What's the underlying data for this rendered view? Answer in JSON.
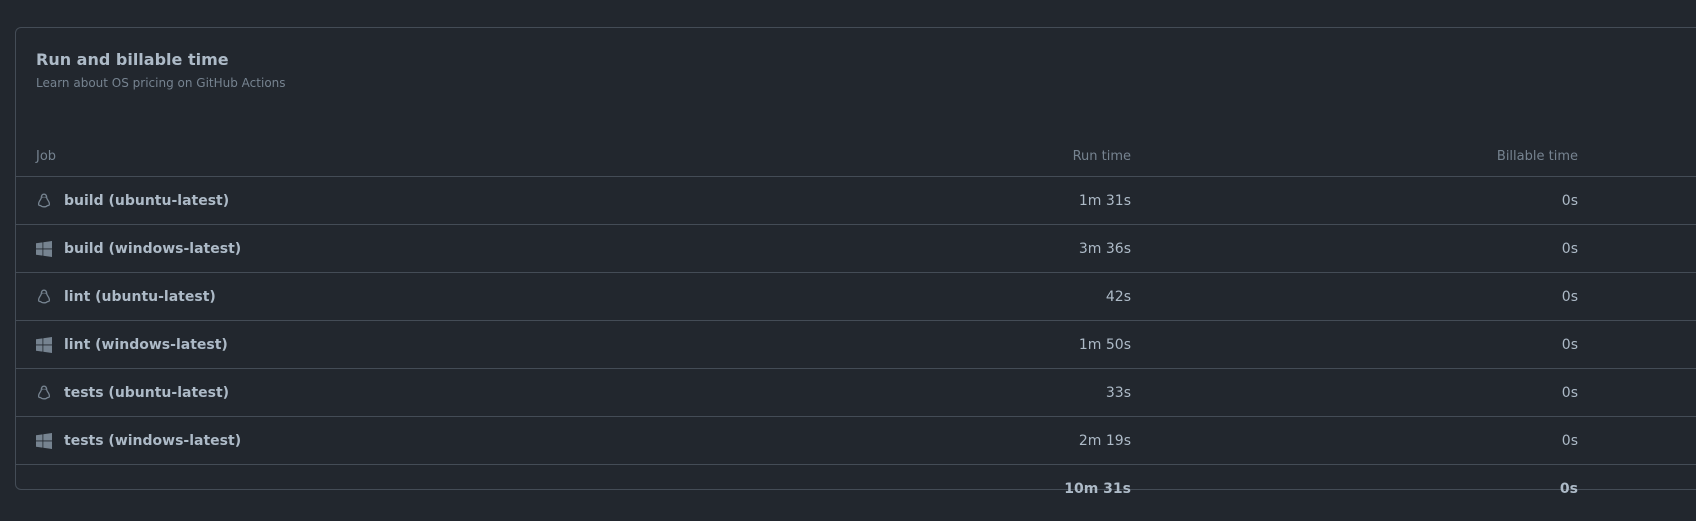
{
  "header": {
    "title": "Run and billable time",
    "subtitle_link": "Learn about OS pricing on GitHub Actions"
  },
  "table": {
    "columns": [
      "Job",
      "Run time",
      "Billable time"
    ],
    "rows": [
      {
        "name": "build (ubuntu-latest)",
        "os_icon": "linux-icon",
        "run_time": "1m 31s",
        "billable_time": "0s"
      },
      {
        "name": "build (windows-latest)",
        "os_icon": "windows-icon",
        "run_time": "3m 36s",
        "billable_time": "0s"
      },
      {
        "name": "lint (ubuntu-latest)",
        "os_icon": "linux-icon",
        "run_time": "42s",
        "billable_time": "0s"
      },
      {
        "name": "lint (windows-latest)",
        "os_icon": "windows-icon",
        "run_time": "1m 50s",
        "billable_time": "0s"
      },
      {
        "name": "tests (ubuntu-latest)",
        "os_icon": "linux-icon",
        "run_time": "33s",
        "billable_time": "0s"
      },
      {
        "name": "tests (windows-latest)",
        "os_icon": "windows-icon",
        "run_time": "2m 19s",
        "billable_time": "0s"
      }
    ],
    "total": {
      "run_time": "10m 31s",
      "billable_time": "0s"
    }
  },
  "colors": {
    "background": "#22272e",
    "border": "#444c56",
    "text": "#adbac7",
    "muted": "#768390"
  }
}
